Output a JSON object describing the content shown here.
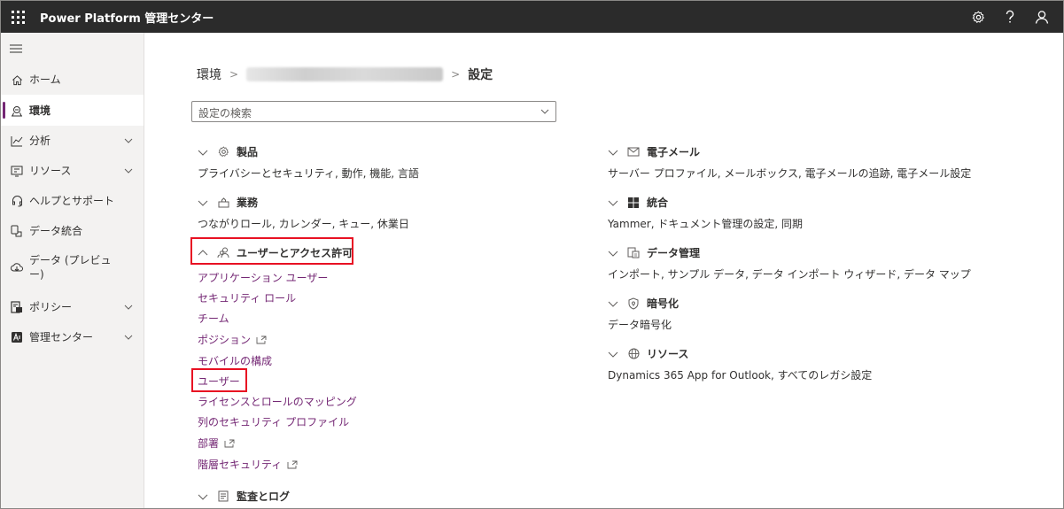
{
  "header": {
    "app_title": "Power Platform 管理センター"
  },
  "sidebar": {
    "items": [
      {
        "label": "ホーム",
        "icon": "home-icon",
        "active": false,
        "expandable": false
      },
      {
        "label": "環境",
        "icon": "environment-icon",
        "active": true,
        "expandable": false
      },
      {
        "label": "分析",
        "icon": "analytics-icon",
        "active": false,
        "expandable": true
      },
      {
        "label": "リソース",
        "icon": "resources-icon",
        "active": false,
        "expandable": true
      },
      {
        "label": "ヘルプとサポート",
        "icon": "headset-icon",
        "active": false,
        "expandable": false
      },
      {
        "label": "データ統合",
        "icon": "data-integration-icon",
        "active": false,
        "expandable": false
      },
      {
        "label": "データ (プレビュー)",
        "icon": "data-preview-icon",
        "active": false,
        "expandable": false
      },
      {
        "label": "ポリシー",
        "icon": "policy-icon",
        "active": false,
        "expandable": true
      },
      {
        "label": "管理センター",
        "icon": "admin-centers-icon",
        "active": false,
        "expandable": true
      }
    ]
  },
  "breadcrumb": {
    "root": "環境",
    "current": "設定"
  },
  "search": {
    "placeholder": "設定の検索"
  },
  "sections_left": {
    "products": {
      "title": "製品",
      "desc": "プライバシーとセキュリティ, 動作, 機能, 言語"
    },
    "business": {
      "title": "業務",
      "desc": "つながりロール, カレンダー, キュー, 休業日"
    },
    "users": {
      "title": "ユーザーとアクセス許可",
      "links": [
        "アプリケーション ユーザー",
        "セキュリティ ロール",
        "チーム",
        "ポジション",
        "モバイルの構成",
        "ユーザー",
        "ライセンスとロールのマッピング",
        "列のセキュリティ プロファイル",
        "部署",
        "階層セキュリティ"
      ]
    },
    "audit": {
      "title": "監査とログ"
    }
  },
  "sections_right": {
    "email": {
      "title": "電子メール",
      "desc": "サーバー プロファイル, メールボックス, 電子メールの追跡, 電子メール設定"
    },
    "integration": {
      "title": "統合",
      "desc": "Yammer, ドキュメント管理の設定, 同期"
    },
    "data_management": {
      "title": "データ管理",
      "desc": "インポート, サンプル データ, データ インポート ウィザード, データ マップ"
    },
    "encryption": {
      "title": "暗号化",
      "desc": "データ暗号化"
    },
    "resources": {
      "title": "リソース",
      "desc": "Dynamics 365 App for Outlook, すべてのレガシ設定"
    }
  },
  "colors": {
    "topbar": "#2b2b2b",
    "accent": "#742774",
    "highlight": "#e81123"
  }
}
